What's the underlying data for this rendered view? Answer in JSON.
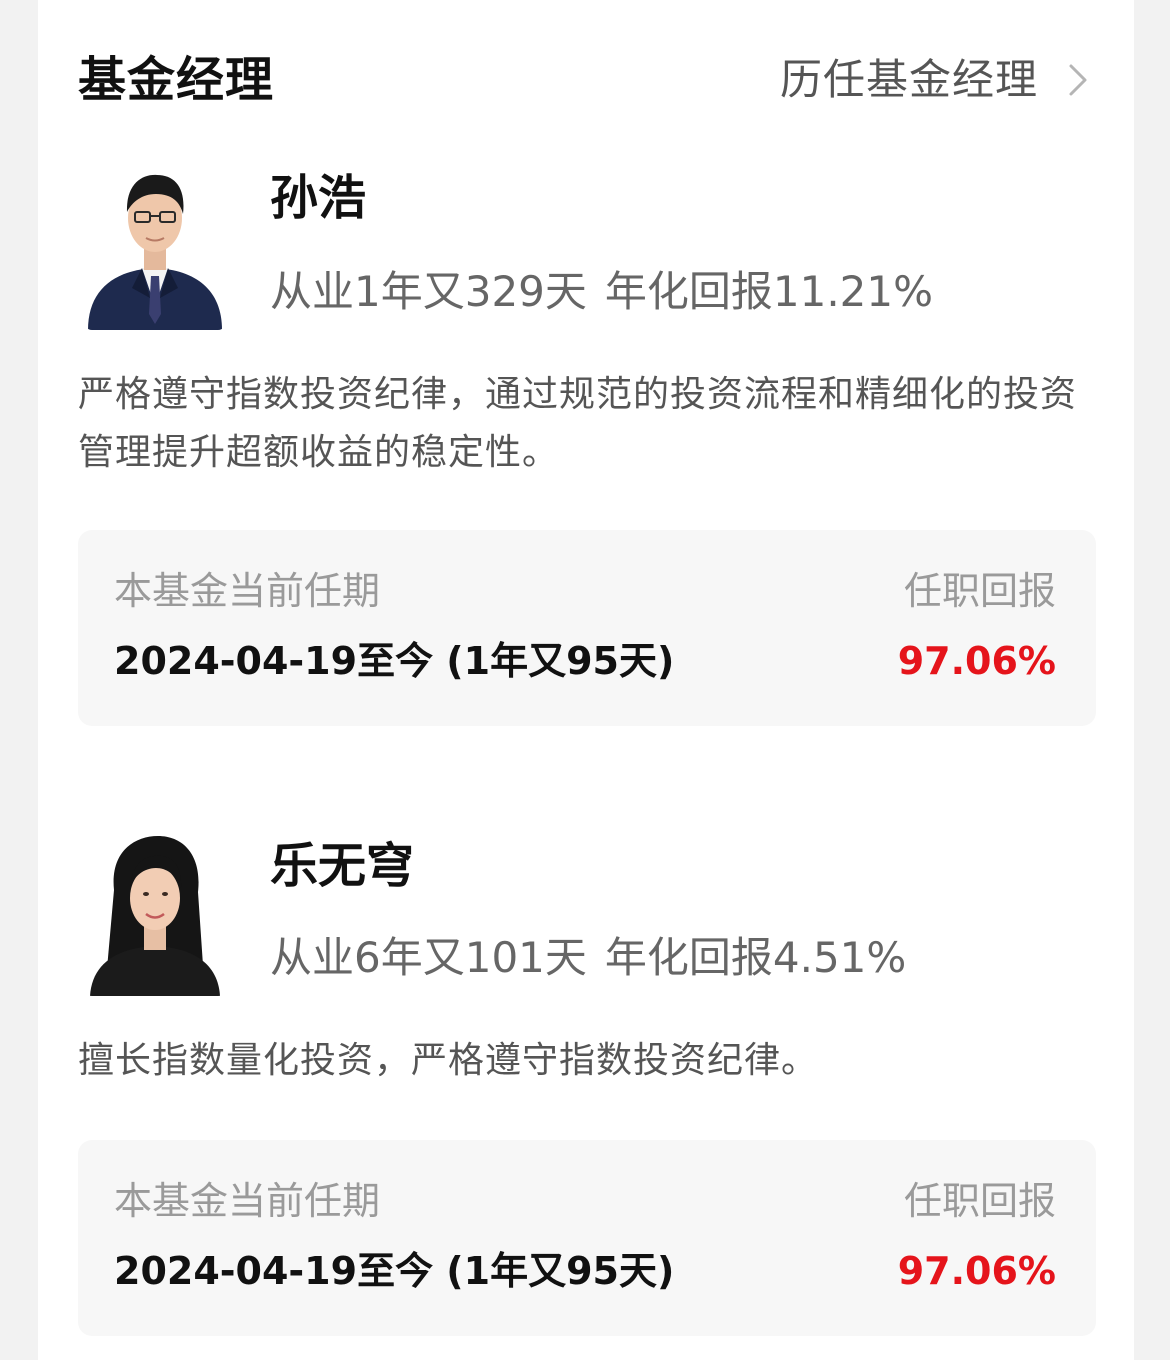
{
  "section": {
    "title": "基金经理",
    "history_link": "历任基金经理"
  },
  "managers": [
    {
      "name": "孙浩",
      "experience": "从业1年又329天",
      "annual_return": "年化回报11.21%",
      "bio": "严格遵守指数投资纪律，通过规范的投资流程和精细化的投资管理提升超额收益的稳定性。",
      "tenure_label": "本基金当前任期",
      "tenure_period": "2024-04-19至今 (1年又95天)",
      "return_label": "任职回报",
      "tenure_return": "97.06%"
    },
    {
      "name": "乐无穹",
      "experience": "从业6年又101天",
      "annual_return": "年化回报4.51%",
      "bio": "擅长指数量化投资，严格遵守指数投资纪律。",
      "tenure_label": "本基金当前任期",
      "tenure_period": "2024-04-19至今 (1年又95天)",
      "return_label": "任职回报",
      "tenure_return": "97.06%"
    }
  ],
  "colors": {
    "return_red": "#e5141b",
    "page_bg": "#f2f2f2",
    "box_bg": "#f7f7f7"
  },
  "icons": {
    "history_link": "chevron-right-icon",
    "manager_1_avatar": "male-portrait",
    "manager_2_avatar": "female-portrait"
  }
}
